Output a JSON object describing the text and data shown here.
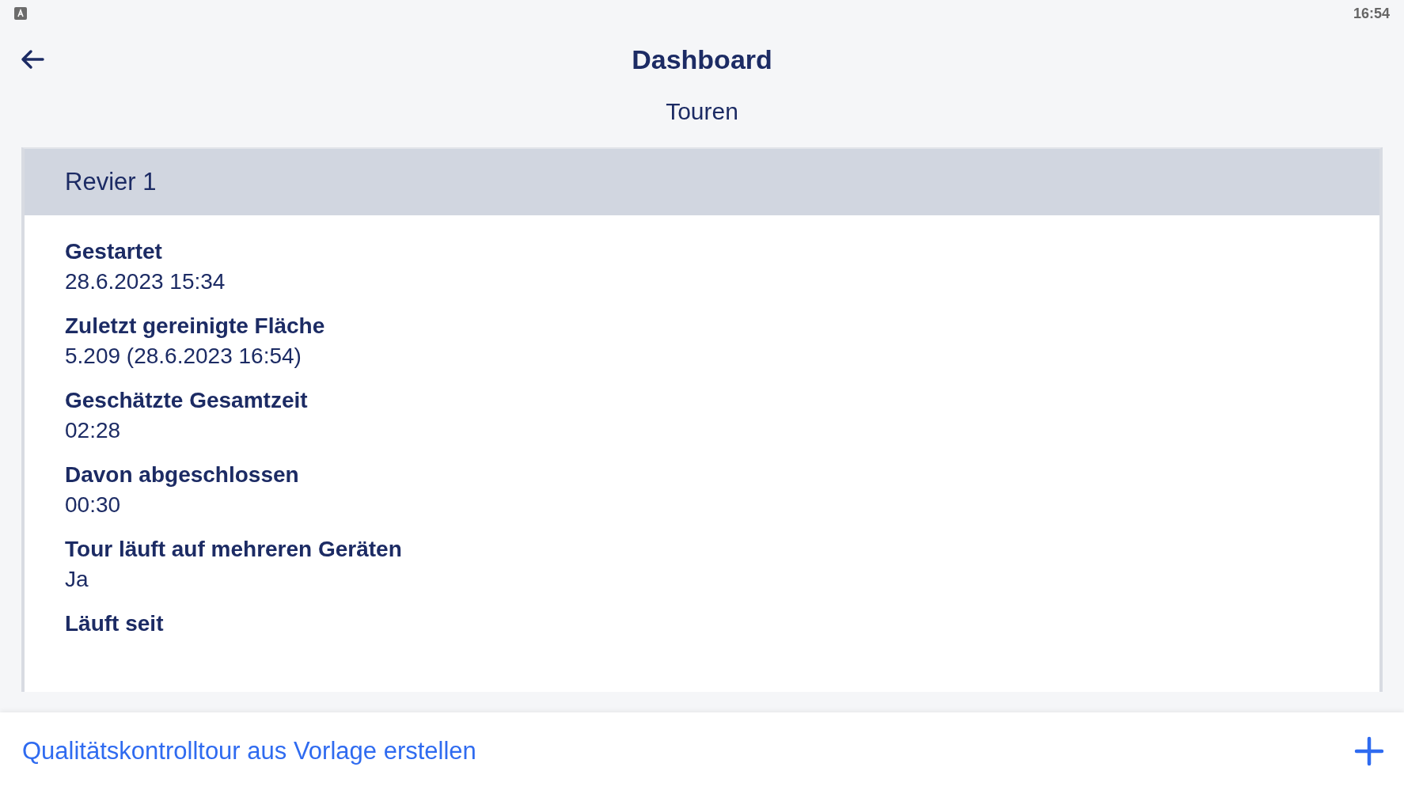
{
  "status_bar": {
    "time": "16:54"
  },
  "header": {
    "title": "Dashboard",
    "subtitle": "Touren"
  },
  "card": {
    "title": "Revier 1",
    "fields": [
      {
        "label": "Gestartet",
        "value": "28.6.2023 15:34"
      },
      {
        "label": "Zuletzt gereinigte Fläche",
        "value": "5.209 (28.6.2023 16:54)"
      },
      {
        "label": "Geschätzte Gesamtzeit",
        "value": "02:28"
      },
      {
        "label": "Davon abgeschlossen",
        "value": "00:30"
      },
      {
        "label": "Tour läuft auf mehreren Geräten",
        "value": "Ja"
      },
      {
        "label": "Läuft seit"
      }
    ]
  },
  "footer": {
    "action": "Qualitätskontrolltour aus Vorlage erstellen"
  }
}
